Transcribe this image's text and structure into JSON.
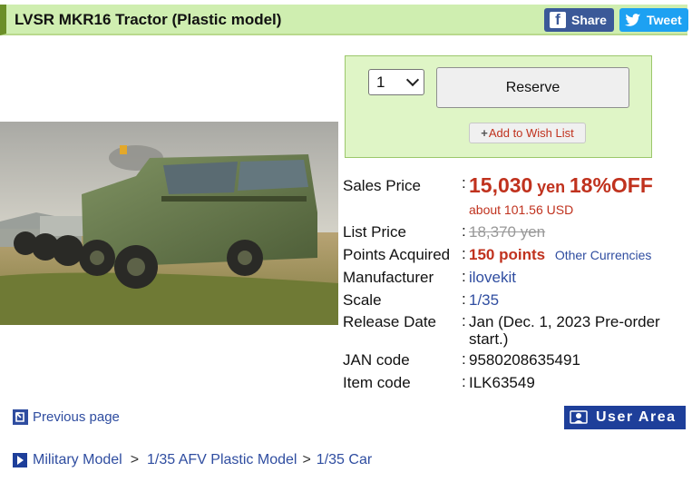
{
  "header": {
    "title": "LVSR MKR16 Tractor (Plastic model)",
    "share_label": "Share",
    "tweet_label": "Tweet"
  },
  "order": {
    "quantity": "1",
    "reserve_label": "Reserve",
    "wishlist_label": "Add to Wish List"
  },
  "details": {
    "sales_price_label": "Sales Price",
    "sales_price": "15,030",
    "sales_price_unit": "yen",
    "discount": "18%OFF",
    "usd_equiv": "about 101.56 USD",
    "list_price_label": "List Price",
    "list_price": "18,370 yen",
    "points_label": "Points Acquired",
    "points": "150 points",
    "other_currencies": "Other Currencies",
    "manufacturer_label": "Manufacturer",
    "manufacturer": "ilovekit",
    "scale_label": "Scale",
    "scale": "1/35",
    "release_label": "Release Date",
    "release_line1": "Jan (Dec. 1, 2023 Pre-order",
    "release_line2": "start.)",
    "jan_label": "JAN code",
    "jan": "9580208635491",
    "item_label": "Item code",
    "item": "ILK63549",
    "colon": ":"
  },
  "nav": {
    "previous_page": "Previous page",
    "user_area": "User Area"
  },
  "breadcrumb": {
    "items": [
      "Military Model",
      "1/35 AFV Plastic Model",
      "1/35 Car"
    ],
    "sep1": ">",
    "sep2": ">"
  },
  "colors": {
    "header_bg": "#cfeeb0",
    "price_red": "#c0321e",
    "link_blue": "#2f4da0",
    "facebook": "#3b5998",
    "twitter": "#1da1f2",
    "user_area_bg": "#1e3f9a"
  }
}
